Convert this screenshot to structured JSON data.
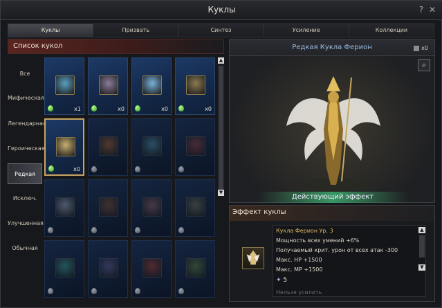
{
  "window": {
    "title": "Куклы",
    "help_label": "?",
    "close_label": "✕"
  },
  "tabs": [
    {
      "label": "Куклы",
      "active": true
    },
    {
      "label": "Призвать",
      "active": false
    },
    {
      "label": "Синтез",
      "active": false
    },
    {
      "label": "Усиление",
      "active": false
    },
    {
      "label": "Коллекции",
      "active": false
    }
  ],
  "list": {
    "header": "Список кукол"
  },
  "categories": [
    {
      "label": "Все",
      "active": false
    },
    {
      "label": "Мифическая",
      "active": false
    },
    {
      "label": "Легендарная",
      "active": false
    },
    {
      "label": "Героическая",
      "active": false
    },
    {
      "label": "Редкая",
      "active": true
    },
    {
      "label": "Исключ.",
      "active": false
    },
    {
      "label": "Улучшенная",
      "active": false
    },
    {
      "label": "Обычная",
      "active": false
    }
  ],
  "dolls": [
    {
      "count": "x1",
      "owned": true,
      "color": "#5aa0c0"
    },
    {
      "count": "x0",
      "owned": true,
      "color": "#8a7c9a"
    },
    {
      "count": "x0",
      "owned": true,
      "color": "#7ab0d8"
    },
    {
      "count": "x0",
      "owned": true,
      "color": "#8a7a50"
    },
    {
      "count": "x0",
      "owned": true,
      "color": "#c8b070",
      "selected": true
    },
    {
      "count": "",
      "owned": false,
      "color": "#a05a2a"
    },
    {
      "count": "",
      "owned": false,
      "color": "#4a8a9a"
    },
    {
      "count": "",
      "owned": false,
      "color": "#8a3a3a"
    },
    {
      "count": "",
      "owned": false,
      "color": "#9aa0b0"
    },
    {
      "count": "",
      "owned": false,
      "color": "#7a4a2a"
    },
    {
      "count": "",
      "owned": false,
      "color": "#8a5a5a"
    },
    {
      "count": "",
      "owned": false,
      "color": "#6a6a50"
    },
    {
      "count": "",
      "owned": false,
      "color": "#3a9a8a"
    },
    {
      "count": "",
      "owned": false,
      "color": "#5a5a8a"
    },
    {
      "count": "",
      "owned": false,
      "color": "#9a3a2a"
    },
    {
      "count": "",
      "owned": false,
      "color": "#5a7a3a"
    }
  ],
  "preview": {
    "name": "Редкая Кукла Ферион",
    "count": "x0",
    "effect_button": "Действующий эффект"
  },
  "effect": {
    "header": "Эффект куклы",
    "title": "Кукла Ферион Ур. 3",
    "lines": [
      "Мощность всех умений +6%",
      "Получаемый крит. урон от всех атак -300",
      "Макс. HP +1500",
      "Макс. MP +1500"
    ],
    "stars": "5",
    "cannot_upgrade": "Нельзя усилить"
  }
}
